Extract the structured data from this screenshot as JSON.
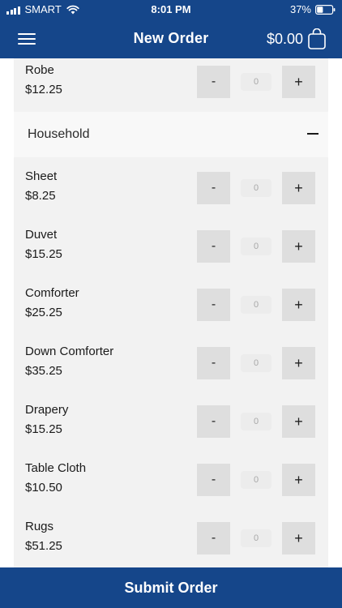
{
  "status_bar": {
    "carrier": "SMART",
    "time": "8:01 PM",
    "battery": "37%"
  },
  "header": {
    "title": "New Order",
    "cart_total": "$0.00"
  },
  "partial_item": {
    "name": "Robe",
    "price": "$12.25",
    "quantity": "0"
  },
  "category": {
    "label": "Household"
  },
  "items": [
    {
      "name": "Sheet",
      "price": "$8.25",
      "quantity": "0"
    },
    {
      "name": "Duvet",
      "price": "$15.25",
      "quantity": "0"
    },
    {
      "name": "Comforter",
      "price": "$25.25",
      "quantity": "0"
    },
    {
      "name": "Down Comforter",
      "price": "$35.25",
      "quantity": "0"
    },
    {
      "name": "Drapery",
      "price": "$15.25",
      "quantity": "0"
    },
    {
      "name": "Table Cloth",
      "price": "$10.50",
      "quantity": "0"
    },
    {
      "name": "Rugs",
      "price": "$51.25",
      "quantity": "0"
    }
  ],
  "buttons": {
    "minus": "-",
    "plus": "+"
  },
  "footer": {
    "submit_label": "Submit Order"
  },
  "colors": {
    "brand": "#15468a",
    "content_bg": "#f2f2f2",
    "stepper_bg": "#dedede"
  }
}
